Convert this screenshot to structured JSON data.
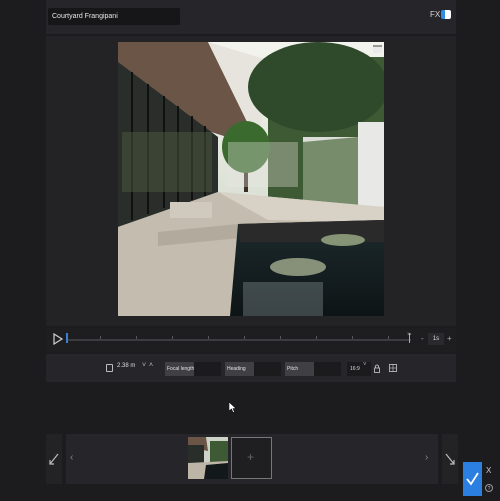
{
  "header": {
    "title": "Courtyard Frangipani",
    "fx_label": "FX"
  },
  "timeline": {
    "end_label": "1s",
    "frames_value": "1s",
    "minus": "-",
    "plus": "+"
  },
  "camera": {
    "height_value": "2.38 m",
    "focal_length_label": "Focal length",
    "heading_label": "Heading",
    "pitch_label": "Pitch",
    "aspect_ratio": "16:9"
  },
  "gallery": {
    "prev": "‹",
    "next": "›"
  },
  "footer": {
    "close": "X"
  },
  "colors": {
    "accent": "#2f8be6",
    "background": "#1c1c1f",
    "panel": "#26262a"
  },
  "icons": [
    "play-icon",
    "height-icon",
    "lock-icon",
    "grid-icon",
    "expand-icon",
    "checkmark-icon",
    "help-icon"
  ]
}
